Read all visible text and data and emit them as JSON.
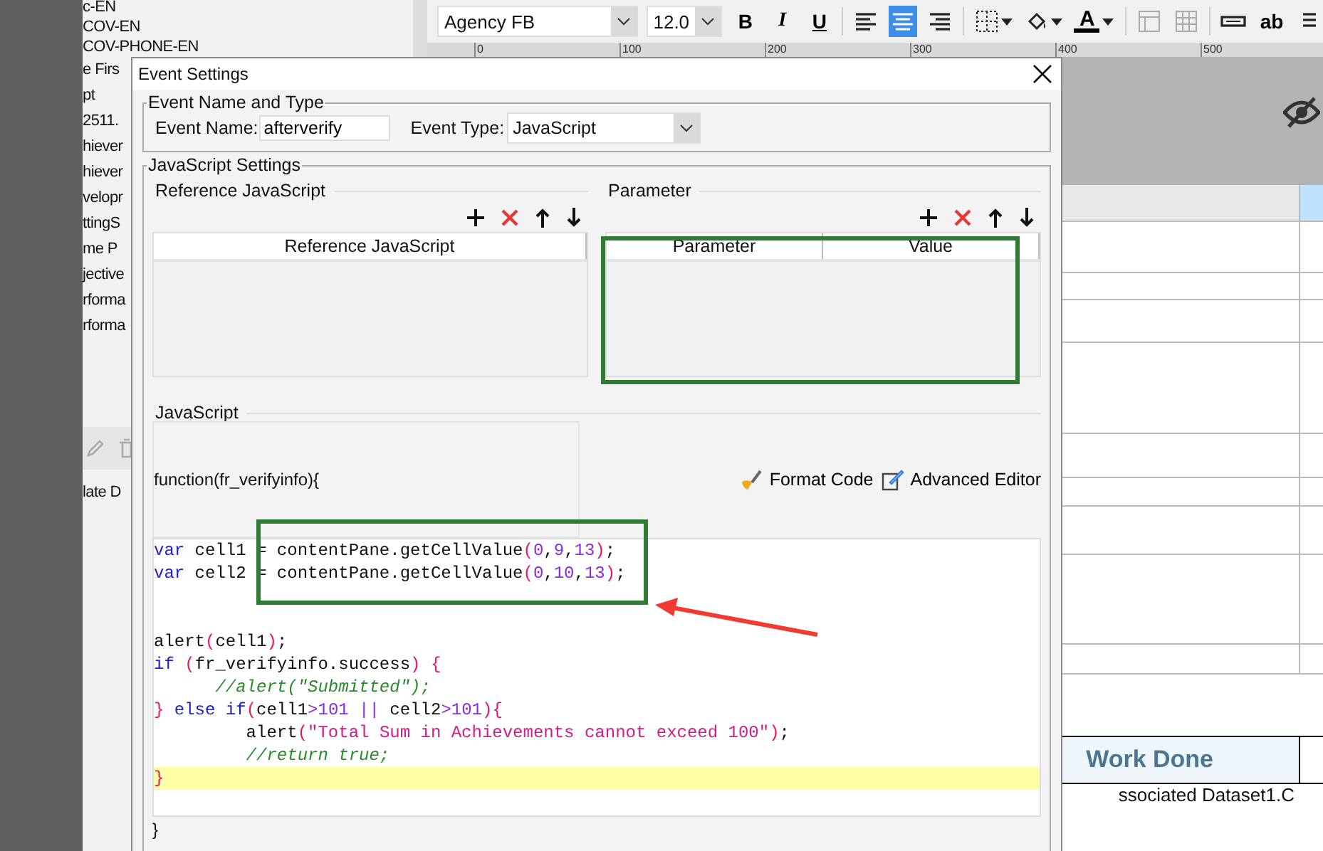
{
  "left_panel": {
    "items": [
      "c-EN",
      "COV-EN",
      "COV-PHONE-EN",
      "e Firs",
      "pt",
      "2511.",
      "hiever",
      "hiever",
      "velopr",
      "ttingS",
      "me P",
      "jective",
      "rforma",
      "rforma"
    ],
    "footer_label": "late D"
  },
  "toolbar": {
    "font": "Agency FB",
    "size": "12.0",
    "buttons": [
      {
        "kind": "bold",
        "label": "B",
        "selected": false
      },
      {
        "kind": "italic",
        "label": "I",
        "selected": false
      },
      {
        "kind": "underline",
        "label": "U",
        "selected": false
      },
      {
        "kind": "align-left",
        "selected": false
      },
      {
        "kind": "align-center",
        "selected": true
      },
      {
        "kind": "align-right",
        "selected": false
      },
      {
        "kind": "borders",
        "selected": false
      },
      {
        "kind": "fill",
        "selected": false
      },
      {
        "kind": "font-color",
        "label": "A",
        "selected": false
      },
      {
        "kind": "merge",
        "selected": false
      },
      {
        "kind": "grid",
        "selected": false
      },
      {
        "kind": "field",
        "selected": false
      },
      {
        "kind": "text",
        "label": "ab",
        "selected": false
      },
      {
        "kind": "lines",
        "selected": false
      }
    ]
  },
  "ruler": {
    "labels": [
      "0",
      "100",
      "200",
      "300",
      "400",
      "500"
    ]
  },
  "sheet": {
    "header_cell": "Work Done",
    "cell": "ssociated Dataset1.C"
  },
  "dialog": {
    "title": "Event Settings",
    "name_type": {
      "legend": "Event Name and Type",
      "name_label": "Event Name:",
      "name_value": "afterverify",
      "type_label": "Event Type:",
      "type_value": "JavaScript"
    },
    "js_settings": {
      "legend": "JavaScript Settings",
      "reference": {
        "title": "Reference JavaScript",
        "tools": [
          {
            "kind": "add"
          },
          {
            "kind": "remove"
          },
          {
            "kind": "up"
          },
          {
            "kind": "down"
          }
        ],
        "columns": [
          "Reference JavaScript"
        ]
      },
      "parameter": {
        "title": "Parameter",
        "tools": [
          {
            "kind": "add"
          },
          {
            "kind": "remove"
          },
          {
            "kind": "up"
          },
          {
            "kind": "down"
          }
        ],
        "columns": [
          "Parameter",
          "Value"
        ]
      },
      "script": {
        "title": "JavaScript",
        "signature": "function(fr_verifyinfo){",
        "actions": [
          {
            "kind": "format",
            "label": "Format Code"
          },
          {
            "kind": "advanced",
            "label": "Advanced Editor"
          }
        ],
        "code_lines": [
          {
            "current": false,
            "tokens": [
              {
                "kind": "kw",
                "text": "var"
              },
              {
                "kind": "id",
                "text": " cell1 = contentPane.getCellValue"
              },
              {
                "kind": "paren",
                "text": "("
              },
              {
                "kind": "num",
                "text": "0"
              },
              {
                "kind": "id",
                "text": ","
              },
              {
                "kind": "num",
                "text": "9"
              },
              {
                "kind": "id",
                "text": ","
              },
              {
                "kind": "num",
                "text": "13"
              },
              {
                "kind": "paren",
                "text": ")"
              },
              {
                "kind": "id",
                "text": ";"
              }
            ]
          },
          {
            "current": false,
            "tokens": [
              {
                "kind": "kw",
                "text": "var"
              },
              {
                "kind": "id",
                "text": " cell2 = contentPane.getCellValue"
              },
              {
                "kind": "paren",
                "text": "("
              },
              {
                "kind": "num",
                "text": "0"
              },
              {
                "kind": "id",
                "text": ","
              },
              {
                "kind": "num",
                "text": "10"
              },
              {
                "kind": "id",
                "text": ","
              },
              {
                "kind": "num",
                "text": "13"
              },
              {
                "kind": "paren",
                "text": ")"
              },
              {
                "kind": "id",
                "text": ";"
              }
            ]
          },
          {
            "current": false
          },
          {
            "current": false
          },
          {
            "current": false,
            "tokens": [
              {
                "kind": "id",
                "text": "alert"
              },
              {
                "kind": "paren",
                "text": "("
              },
              {
                "kind": "id",
                "text": "cell1"
              },
              {
                "kind": "paren",
                "text": ")"
              },
              {
                "kind": "id",
                "text": ";"
              }
            ]
          },
          {
            "current": false,
            "tokens": [
              {
                "kind": "kw",
                "text": "if"
              },
              {
                "kind": "paren",
                "text": " ("
              },
              {
                "kind": "id",
                "text": "fr_verifyinfo.success"
              },
              {
                "kind": "paren",
                "text": ") {"
              }
            ]
          },
          {
            "current": false,
            "tokens": [
              {
                "kind": "cmt",
                "text": "      //alert(\"Submitted\");"
              }
            ]
          },
          {
            "current": false,
            "tokens": [
              {
                "kind": "paren",
                "text": "} "
              },
              {
                "kind": "kw",
                "text": "else if"
              },
              {
                "kind": "paren",
                "text": "("
              },
              {
                "kind": "id",
                "text": "cell1"
              },
              {
                "kind": "op",
                "text": ">"
              },
              {
                "kind": "num",
                "text": "101"
              },
              {
                "kind": "op",
                "text": " || "
              },
              {
                "kind": "id",
                "text": "cell2"
              },
              {
                "kind": "op",
                "text": ">"
              },
              {
                "kind": "num",
                "text": "101"
              },
              {
                "kind": "paren",
                "text": "){"
              }
            ]
          },
          {
            "current": false,
            "tokens": [
              {
                "kind": "id",
                "text": "         alert"
              },
              {
                "kind": "paren",
                "text": "("
              },
              {
                "kind": "str",
                "text": "\"Total Sum in Achievements cannot exceed 100\""
              },
              {
                "kind": "paren",
                "text": ")"
              },
              {
                "kind": "id",
                "text": ";"
              }
            ]
          },
          {
            "current": false,
            "tokens": [
              {
                "kind": "cmt",
                "text": "         //return true;"
              }
            ]
          },
          {
            "current": true,
            "tokens": [
              {
                "kind": "paren",
                "text": "}"
              }
            ]
          },
          {
            "current": false
          }
        ],
        "closing": "}"
      }
    }
  },
  "annotations": [
    {
      "kind": "frame"
    },
    {
      "kind": "frame"
    },
    {
      "kind": "arrow"
    }
  ]
}
